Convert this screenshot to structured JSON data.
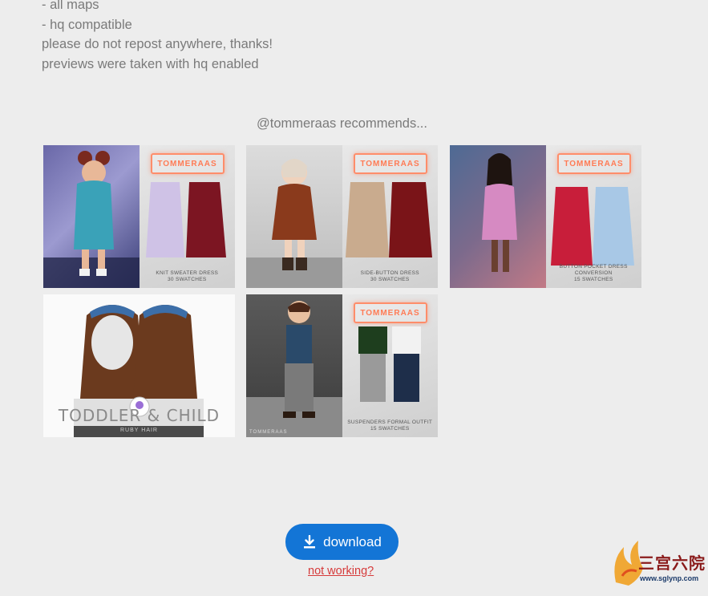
{
  "description": {
    "lines": [
      "- all maps",
      "- hq compatible",
      "please do not repost anywhere, thanks!",
      "previews were taken with hq enabled"
    ]
  },
  "recommendations": {
    "title": "@tommeraas recommends...",
    "brand_sign": "TOMMERAAS",
    "items": [
      {
        "caption_line1": "KNIT SWEATER DRESS",
        "caption_line2": "30 SWATCHES"
      },
      {
        "caption_line1": "SIDE-BUTTON DRESS",
        "caption_line2": "30 SWATCHES"
      },
      {
        "caption_line1": "BUTTON POCKET DRESS CONVERSION",
        "caption_line2": "15 SWATCHES"
      },
      {
        "caption_line1": "TODDLER & CHILD",
        "caption_line2": "RUBY HAIR"
      },
      {
        "caption_line1": "SUSPENDERS FORMAL OUTFIT",
        "caption_line2": "15 SWATCHES",
        "tag": "TOMMERAAS"
      }
    ]
  },
  "download": {
    "label": "download"
  },
  "not_working": {
    "label": "not working?"
  },
  "watermark": {
    "brand": "三宫六院",
    "url": "www.sglynp.com"
  },
  "colors": {
    "background": "#ededed",
    "text": "#7a7a7a",
    "button": "#1375d6",
    "link": "#d63a3a"
  }
}
